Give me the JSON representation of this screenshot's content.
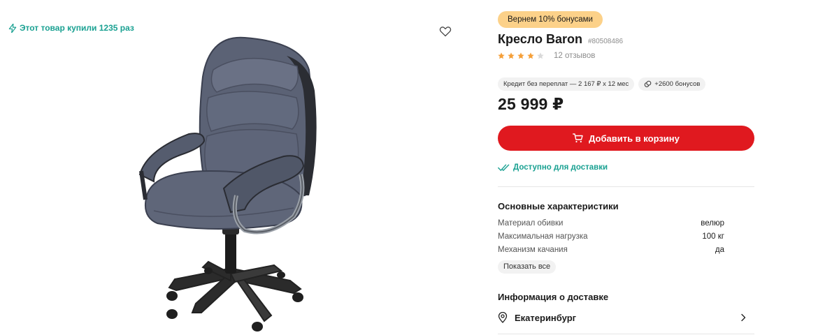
{
  "popularity": {
    "text": "Этот товар купили 1235 раз",
    "icon": "lightning-icon"
  },
  "product": {
    "bonus_badge": "Вернем 10% бонусами",
    "title": "Кресло Baron",
    "sku": "#80508486",
    "rating": 4,
    "rating_max": 5,
    "reviews": "12 отзывов",
    "credit_chip": "Кредит без переплат — 2 167 ₽ х 12 мес",
    "bonus_chip": "+2600 бонусов",
    "price": "25 999 ₽",
    "add_to_cart": "Добавить в корзину",
    "delivery": "Доступно для доставки"
  },
  "specs": {
    "title": "Основные характеристики",
    "rows": [
      {
        "label": "Материал обивки",
        "value": "велюр"
      },
      {
        "label": "Максимальная нагрузка",
        "value": "100 кг"
      },
      {
        "label": "Механизм качания",
        "value": "да"
      }
    ],
    "show_all": "Показать все"
  },
  "delivery_info": {
    "title": "Информация о доставке",
    "city": "Екатеринбург"
  },
  "colors": {
    "accent_red": "#e0191f",
    "teal": "#1aa192",
    "badge_yellow": "#fcd189",
    "star_orange": "#f59f38",
    "star_gray": "#d9d9d9"
  }
}
